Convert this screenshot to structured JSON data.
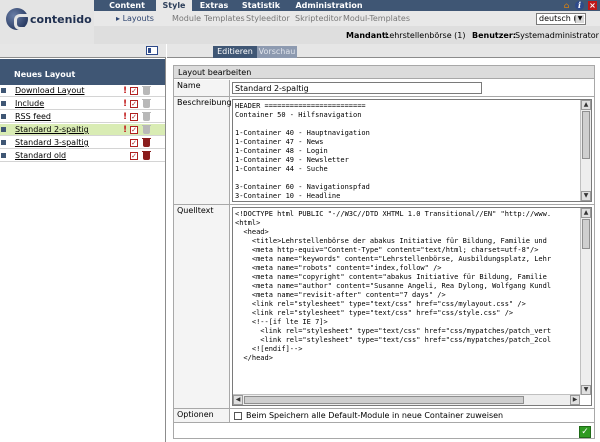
{
  "app": {
    "logo_text": "contenido"
  },
  "main_nav": [
    {
      "label": "Content",
      "active": false
    },
    {
      "label": "Style",
      "active": true
    },
    {
      "label": "Extras",
      "active": false
    },
    {
      "label": "Statistik",
      "active": false
    },
    {
      "label": "Administration",
      "active": false
    }
  ],
  "sub_nav": [
    {
      "label": "Layouts",
      "active": true
    },
    {
      "label": "Module",
      "active": false
    },
    {
      "label": "Templates",
      "active": false
    },
    {
      "label": "Styleeditor",
      "active": false
    },
    {
      "label": "Skripteditor",
      "active": false
    },
    {
      "label": "Modul-Templates",
      "active": false
    }
  ],
  "language": {
    "selected": "deutsch (1)"
  },
  "info_bar": {
    "client_label": "Mandant:",
    "client_value": "Lehrstellenbörse (1)",
    "user_label": "Benutzer:",
    "user_value": "Systemadministrator"
  },
  "left": {
    "new_layout": "Neues Layout",
    "layouts": [
      {
        "name": "Download Layout",
        "in_use": true,
        "deletable": false,
        "active": false
      },
      {
        "name": "Include",
        "in_use": true,
        "deletable": false,
        "active": false
      },
      {
        "name": "RSS feed",
        "in_use": true,
        "deletable": false,
        "active": false
      },
      {
        "name": "Standard 2-spaltig",
        "in_use": true,
        "deletable": false,
        "active": true
      },
      {
        "name": "Standard 3-spaltig",
        "in_use": false,
        "deletable": true,
        "active": false
      },
      {
        "name": "Standard old",
        "in_use": false,
        "deletable": true,
        "active": false
      }
    ]
  },
  "tabs": {
    "edit": "Editieren",
    "preview": "Vorschau"
  },
  "form": {
    "title": "Layout bearbeiten",
    "name_label": "Name",
    "name_value": "Standard 2-spaltig",
    "description_label": "Beschreibung",
    "description_text": "HEADER ========================\nContainer 50 - Hilfsnavigation\n\n1-Container 40 - Hauptnavigation\n1-Container 47 - News\n1-Container 48 - Login\n1-Container 49 - Newsletter\n1-Container 44 - Suche\n\n3-Container 60 - Navigationspfad\n3-Container 10 - Headline",
    "source_label": "Quelltext",
    "source_text": "<!DOCTYPE html PUBLIC \"-//W3C//DTD XHTML 1.0 Transitional//EN\" \"http://www.\n<html>\n  <head>\n    <title>Lehrstellenbörse der abakus Initiative für Bildung, Familie und\n    <meta http-equiv=\"Content-Type\" content=\"text/html; charset=utf-8\"/>\n    <meta name=\"keywords\" content=\"Lehrstellenbörse, Ausbildungsplatz, Lehr\n    <meta name=\"robots\" content=\"index,follow\" />\n    <meta name=\"copyright\" content=\"abakus Initiative für Bildung, Familie\n    <meta name=\"author\" content=\"Susanne Angeli, Rea Dylong, Wolfgang Kundl\n    <meta name=\"revisit-after\" content=\"7 days\" />\n    <link rel=\"stylesheet\" type=\"text/css\" href=\"css/mylayout.css\" />\n    <link rel=\"stylesheet\" type=\"text/css\" href=\"css/style.css\" />\n    <!--[if lte IE 7]>\n      <link rel=\"stylesheet\" type=\"text/css\" href=\"css/mypatches/patch_vert\n      <link rel=\"stylesheet\" type=\"text/css\" href=\"css/mypatches/patch_2col\n    <![endif]-->\n  </head>",
    "options_label": "Optionen",
    "options_text": "Beim Speichern alle Default-Module in neue Container zuweisen"
  },
  "colors": {
    "nav_blue": "#3f5674",
    "active_row": "#d9ecb4",
    "save_green": "#2f9a22",
    "alert_red": "#c01818"
  }
}
